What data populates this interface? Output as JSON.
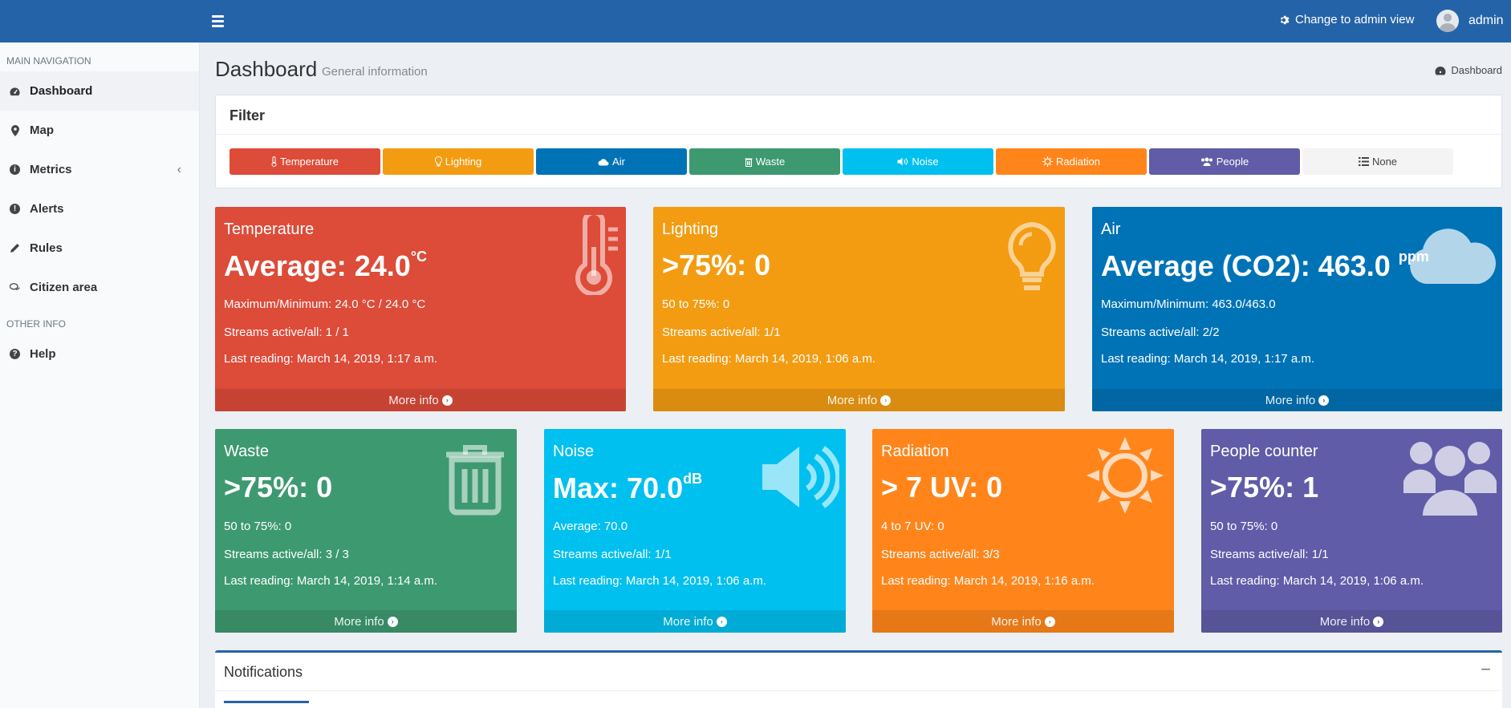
{
  "topbar": {
    "admin_view_label": "Change to admin view",
    "user_name": "admin",
    "color": "#2563a8"
  },
  "sidebar": {
    "main_header": "MAIN NAVIGATION",
    "other_header": "OTHER INFO",
    "items": [
      {
        "label": "Dashboard",
        "icon": "dashboard-icon",
        "active": true
      },
      {
        "label": "Map",
        "icon": "map-marker-icon"
      },
      {
        "label": "Metrics",
        "icon": "info-circle-icon",
        "has_children": true
      },
      {
        "label": "Alerts",
        "icon": "exclamation-circle-icon"
      },
      {
        "label": "Rules",
        "icon": "pencil-icon"
      },
      {
        "label": "Citizen area",
        "icon": "comments-icon"
      }
    ],
    "other_items": [
      {
        "label": "Help",
        "icon": "question-circle-icon"
      }
    ]
  },
  "header": {
    "title": "Dashboard",
    "subtitle": "General information",
    "breadcrumb": "Dashboard"
  },
  "filter": {
    "title": "Filter",
    "buttons": [
      {
        "label": "Temperature",
        "icon": "thermometer-icon",
        "color": "#dd4b39"
      },
      {
        "label": "Lighting",
        "icon": "lightbulb-icon",
        "color": "#f39c12"
      },
      {
        "label": "Air",
        "icon": "cloud-icon",
        "color": "#0073b7"
      },
      {
        "label": "Waste",
        "icon": "trash-icon",
        "color": "#3d9970"
      },
      {
        "label": "Noise",
        "icon": "volume-icon",
        "color": "#00c0ef"
      },
      {
        "label": "Radiation",
        "icon": "sun-icon",
        "color": "#ff851b"
      },
      {
        "label": "People",
        "icon": "users-icon",
        "color": "#605ca8"
      },
      {
        "label": "None",
        "icon": "list-icon",
        "color": "#f4f4f4"
      }
    ]
  },
  "cards": {
    "temperature": {
      "title": "Temperature",
      "big": "Average: 24.0",
      "big_unit": "°C",
      "line1": "Maximum/Minimum: 24.0 °C / 24.0 °C",
      "line2": "Streams active/all: 1 / 1",
      "line3": "Last reading: March 14, 2019, 1:17 a.m.",
      "more": "More info",
      "color": "#dd4b39",
      "footer_color": "#c64333"
    },
    "lighting": {
      "title": "Lighting",
      "big": ">75%: 0",
      "line1": "50 to 75%: 0",
      "line2": "Streams active/all: 1/1",
      "line3": "Last reading: March 14, 2019, 1:06 a.m.",
      "more": "More info",
      "color": "#f39c12",
      "footer_color": "#da8c10"
    },
    "air": {
      "title": "Air",
      "big": "Average (CO2): 463.0",
      "big_unit": "ppm",
      "line1": "Maximum/Minimum: 463.0/463.0",
      "line2": "Streams active/all: 2/2",
      "line3": "Last reading: March 14, 2019, 1:17 a.m.",
      "more": "More info",
      "color": "#0073b7",
      "footer_color": "#0067a4"
    },
    "waste": {
      "title": "Waste",
      "big": ">75%: 0",
      "line1": "50 to 75%: 0",
      "line2": "Streams active/all: 3 / 3",
      "line3": "Last reading: March 14, 2019, 1:14 a.m.",
      "more": "More info",
      "color": "#3d9970",
      "footer_color": "#378a64"
    },
    "noise": {
      "title": "Noise",
      "big": "Max: 70.0",
      "big_unit": "dB",
      "line1": "Average: 70.0",
      "line2": "Streams active/all: 1/1",
      "line3": "Last reading: March 14, 2019, 1:06 a.m.",
      "more": "More info",
      "color": "#00c0ef",
      "footer_color": "#00acd6"
    },
    "radiation": {
      "title": "Radiation",
      "big": "> 7 UV: 0",
      "line1": "4 to 7 UV: 0",
      "line2": "Streams active/all: 3/3",
      "line3": "Last reading: March 14, 2019, 1:16 a.m.",
      "more": "More info",
      "color": "#ff851b",
      "footer_color": "#e67818"
    },
    "people": {
      "title": "People counter",
      "big": ">75%: 1",
      "line1": "50 to 75%: 0",
      "line2": "Streams active/all: 1/1",
      "line3": "Last reading: March 14, 2019, 1:06 a.m.",
      "more": "More info",
      "color": "#605ca8",
      "footer_color": "#565397"
    }
  },
  "notifications": {
    "title": "Notifications",
    "collapse": "−"
  }
}
